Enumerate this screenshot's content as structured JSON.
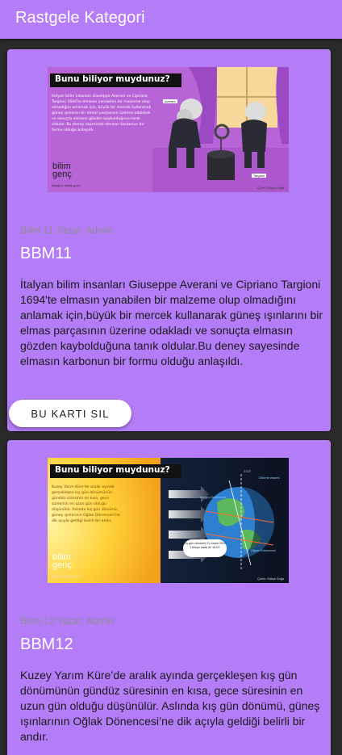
{
  "app_bar": {
    "title": "Rastgele Kategori"
  },
  "posts": [
    {
      "category": "Bilim",
      "number": "11",
      "author_label": "Yazar:",
      "author": "Admin",
      "title": "BBM11",
      "body": "İtalyan bilim insanları Giuseppe Averani ve Cipriano Targioni 1694'te elmasın yanabilen bir malzeme olup olmadığını anlamak için,büyük bir mercek kullanarak güneş ışınlarını bir elmas parçasının üzerine odakladı ve sonuçta elmasın gözden kaybolduğuna tanık oldular.Bu deney sayesinde elmasın karbonun bir formu olduğu anlaşıldı.",
      "delete_label": "BU KARTI SIL",
      "image": {
        "heading": "Bunu biliyor muydunuz?",
        "caption": "İtalyan bilim insanları Giuseppe Averani ve Cipriano Targioni 1694'te elmasın yanabilen bir malzeme olup olmadığını anlamak için, büyük bir mercek kullanarak güneş ışınlarını bir elmas parçasının üzerine odakladı ve sonuçta elmasın gözden kaybolduğuna tanık oldular. Bu deney sayesinde elmasın karbonun bir formu olduğu anlaşıldı.",
        "brand_line1": "bilim",
        "brand_line2": "genç",
        "url": "bilimgenc.tubitak.gov.tr",
        "credit": "Çizim: Gökçe Doğa",
        "label_left": "Averani",
        "label_right": "Targioni"
      }
    },
    {
      "category": "Bilim",
      "number": "12",
      "author_label": "Yazar:",
      "author": "Admin",
      "title": "BBM12",
      "body": "Kuzey Yarım Küre’de aralık ayında gerçekleşen kış gün dönümünün gündüz süresinin en kısa, gece süresinin en uzun gün olduğu düşünülür. Aslında kış gün dönümü, güneş ışınlarının Oğlak Dönencesi’ne dik açıyla geldiği belirli bir andır.",
      "image": {
        "heading": "Bunu biliyor muydunuz?",
        "caption": "Kuzey Yarım Küre'de aralık ayında gerçekleşen kış gün dönümünün gündüz süresinin en kısa, gece süresinin en uzun gün olduğu düşünülür. Aslında kış gün dönümü, güneş ışınlarının Oğlak Dönencesi'ne dik açıyla geldiği belirli bir andır.",
        "brand_line1": "bilim",
        "brand_line2": "genç",
        "url": "bilimgenc.tubitak.gov.tr",
        "credit": "Çizim: Gökçe Doğa",
        "bubble_text": "Kış gün dönümü 21 Aralık 2020 Türkiye saati ile 16.02",
        "label_cancer": "Yengeç Dönencesi",
        "label_axis": "Dönme ekseni",
        "label_capricorn": "Oğlak Dönencesi",
        "label_degree": "23.5°"
      }
    }
  ],
  "colors": {
    "app_bar": "#b57cf8",
    "card": "#b57cf8",
    "background": "#2a2a2a",
    "meta_text": "#8e8e93",
    "title_text": "#ffffff",
    "button_bg": "#ffffff"
  }
}
